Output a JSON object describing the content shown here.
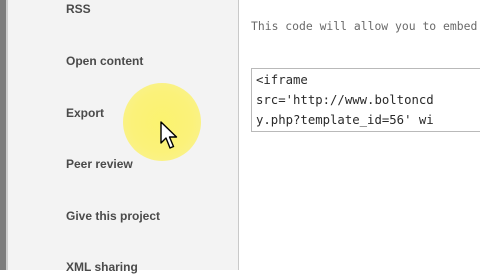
{
  "sidebar": {
    "items": [
      {
        "label": "RSS"
      },
      {
        "label": "Open content"
      },
      {
        "label": "Export"
      },
      {
        "label": "Peer review"
      },
      {
        "label": "Give this project"
      },
      {
        "label": "XML sharing"
      }
    ]
  },
  "main": {
    "intro_text": "This code will allow you to embed",
    "embed_code_lines": [
      "<iframe",
      "src='http://www.boltoncd",
      "y.php?template_id=56' wi"
    ]
  },
  "cursor": {
    "icon": "arrow-pointer-icon",
    "highlight_color": "#fbf27a"
  },
  "colors": {
    "sidebar_bg": "#f3f3f3",
    "menu_text": "#4a4a4a",
    "highlight": "#fbf27a"
  }
}
